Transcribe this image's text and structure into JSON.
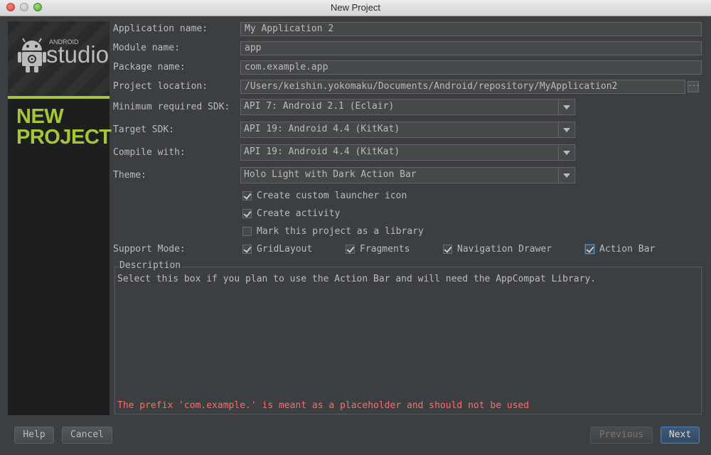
{
  "window": {
    "title": "New Project"
  },
  "banner": {
    "android": "ANDROID",
    "studio": "studio",
    "heading_line1": "NEW",
    "heading_line2": "PROJECT"
  },
  "form": {
    "application_name": {
      "label": "Application name:",
      "value": "My Application 2"
    },
    "module_name": {
      "label": "Module name:",
      "value": "app"
    },
    "package_name": {
      "label": "Package name:",
      "value": "com.example.app"
    },
    "project_location": {
      "label": "Project location:",
      "value": "/Users/keishin.yokomaku/Documents/Android/repository/MyApplication2",
      "browse": "..."
    },
    "min_sdk": {
      "label": "Minimum required SDK:",
      "value": "API 7: Android 2.1 (Eclair)"
    },
    "target_sdk": {
      "label": "Target SDK:",
      "value": "API 19: Android 4.4 (KitKat)"
    },
    "compile_with": {
      "label": "Compile with:",
      "value": "API 19: Android 4.4 (KitKat)"
    },
    "theme": {
      "label": "Theme:",
      "value": "Holo Light with Dark Action Bar"
    }
  },
  "options": {
    "launcher_icon": {
      "label": "Create custom launcher icon",
      "checked": true
    },
    "create_activity": {
      "label": "Create activity",
      "checked": true
    },
    "library": {
      "label": "Mark this project as a library",
      "checked": false
    }
  },
  "support_mode": {
    "label": "Support Mode:",
    "gridlayout": {
      "label": "GridLayout",
      "checked": true
    },
    "fragments": {
      "label": "Fragments",
      "checked": true
    },
    "nav_drawer": {
      "label": "Navigation Drawer",
      "checked": true
    },
    "action_bar": {
      "label": "Action Bar",
      "checked": true
    }
  },
  "description": {
    "legend": "Description",
    "text": "Select this box if you plan to use the Action Bar and will need the AppCompat Library.",
    "warning": "The prefix 'com.example.' is meant as a placeholder and should not be used"
  },
  "buttons": {
    "help": "Help",
    "cancel": "Cancel",
    "previous": "Previous",
    "next": "Next"
  },
  "colors": {
    "accent": "#a4c639",
    "warning": "#ff6b68",
    "background": "#3c3f41"
  }
}
